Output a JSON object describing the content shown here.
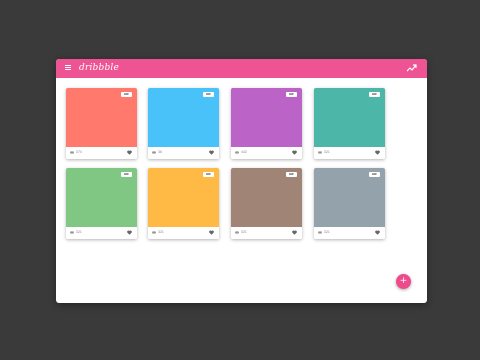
{
  "app": {
    "logo_text": "dribbble",
    "accent_color": "#ee5493",
    "icons": {
      "menu": "menu-icon",
      "trend": "trending-up-icon",
      "views": "eye-icon",
      "like": "heart-icon",
      "fab": "plus-icon"
    }
  },
  "cards": [
    {
      "color": "#ff7a6d",
      "badge": "GIF",
      "views": "374"
    },
    {
      "color": "#49c2f9",
      "badge": "GIF",
      "views": "36"
    },
    {
      "color": "#bb63c7",
      "badge": "GIF",
      "views": "442"
    },
    {
      "color": "#4cb6a9",
      "badge": "GIF",
      "views": "321"
    },
    {
      "color": "#80c784",
      "badge": "GIF",
      "views": "321"
    },
    {
      "color": "#ffba45",
      "badge": "GIF",
      "views": "321"
    },
    {
      "color": "#a08577",
      "badge": "GIF",
      "views": "321"
    },
    {
      "color": "#93a2ab",
      "badge": "GIF",
      "views": "321"
    }
  ],
  "fab": {
    "label": "+"
  }
}
